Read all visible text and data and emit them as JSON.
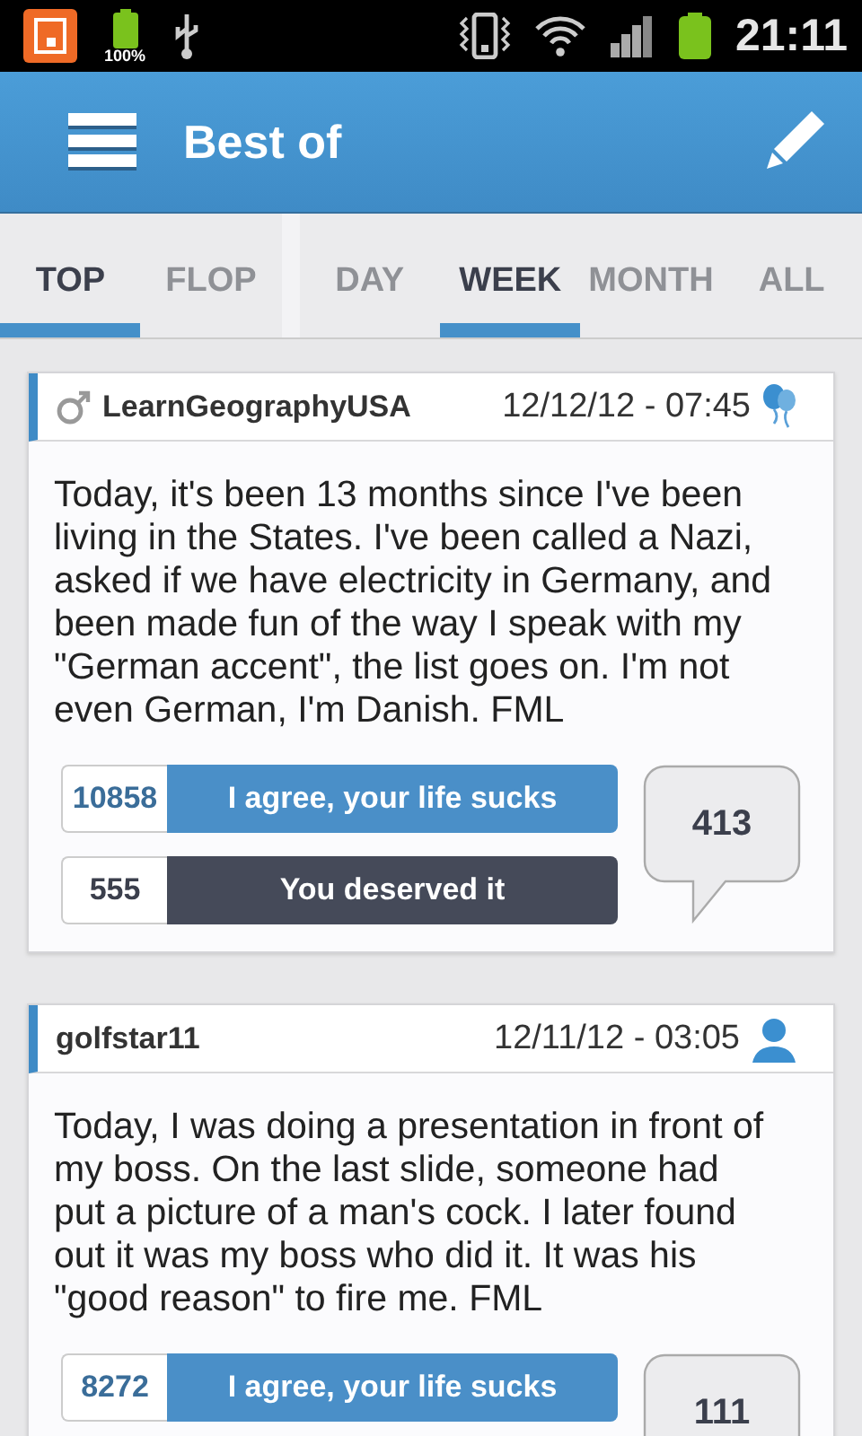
{
  "status_bar": {
    "battery_label": "100%",
    "time": "21:11"
  },
  "app_bar": {
    "title": "Best of"
  },
  "tab_groups": [
    [
      {
        "label": "TOP",
        "selected": true
      },
      {
        "label": "FLOP",
        "selected": false
      }
    ],
    [
      {
        "label": "DAY",
        "selected": false
      },
      {
        "label": "WEEK",
        "selected": true
      },
      {
        "label": "MONTH",
        "selected": false
      },
      {
        "label": "ALL",
        "selected": false
      }
    ]
  ],
  "posts": [
    {
      "author": "LearnGeographyUSA",
      "male": true,
      "kind": "balloons",
      "date": "12/12/12 - 07:45",
      "text": "Today, it's been 13 months since I've been living in the States. I've been called a Nazi, asked if we have electricity in Germany, and been made fun of the way I speak with my \"German accent\", the list goes on. I'm not even German, I'm Danish. FML",
      "votes": [
        {
          "kind": "agree",
          "count": "10858",
          "label": "I agree, your life sucks"
        },
        {
          "kind": "deserved",
          "count": "555",
          "label": "You deserved it"
        }
      ],
      "comments": "413"
    },
    {
      "author": "golfstar11",
      "male": false,
      "kind": "person",
      "date": "12/11/12 - 03:05",
      "text": "Today, I was doing a presentation in front of my boss. On the last slide, someone had put a picture of a man's cock. I later found out it was my boss who did it. It was his \"good reason\" to fire me. FML",
      "votes": [
        {
          "kind": "agree",
          "count": "8272",
          "label": "I agree, your life sucks"
        }
      ],
      "comments": "111"
    }
  ]
}
